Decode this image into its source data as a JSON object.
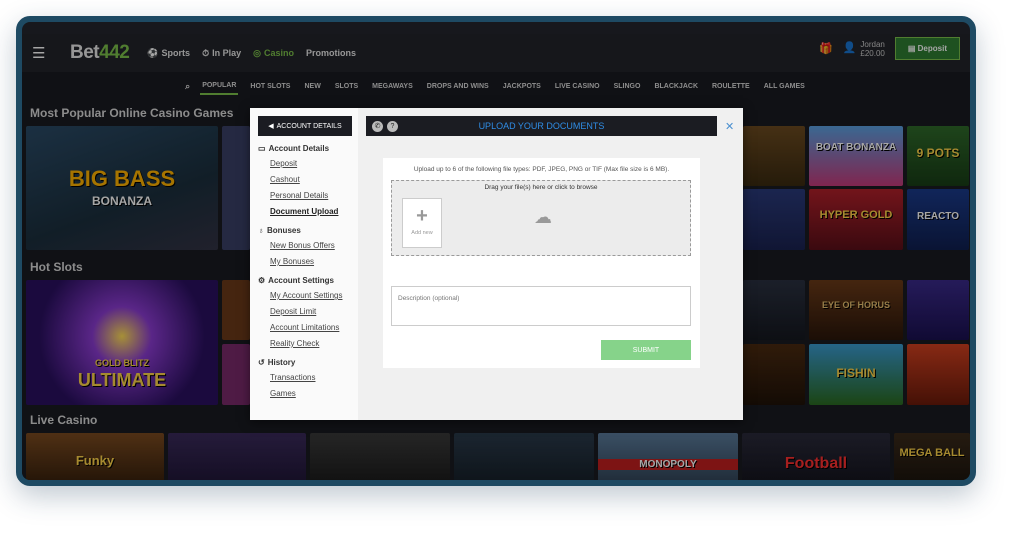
{
  "header": {
    "logo_prefix": "Bet",
    "logo_suffix": "442",
    "nav": [
      {
        "label": "Sports",
        "icon": "soccer-ball-icon"
      },
      {
        "label": "In Play",
        "icon": "stopwatch-icon"
      },
      {
        "label": "Casino",
        "icon": "chips-icon"
      },
      {
        "label": "Promotions",
        "icon": ""
      }
    ],
    "user_name": "Jordan",
    "balance": "£20.00",
    "deposit_label": "Deposit"
  },
  "categories": [
    "POPULAR",
    "HOT SLOTS",
    "NEW",
    "SLOTS",
    "MEGAWAYS",
    "DROPS AND WINS",
    "JACKPOTS",
    "LIVE CASINO",
    "SLINGO",
    "BLACKJACK",
    "ROULETTE",
    "ALL GAMES"
  ],
  "sections": {
    "popular": "Most Popular Online Casino Games",
    "hot": "Hot Slots",
    "live": "Live Casino"
  },
  "games": {
    "big_bass": "BIG BASS",
    "bonanza": "BONANZA",
    "boat_bonanza": "BOAT BONANZA",
    "nine_pots": "9 POTS",
    "hyper_gold": "HYPER GOLD",
    "reactoonz": "REACTO",
    "gold_blitz": "GOLD BLITZ",
    "ultimate": "ULTIMATE",
    "eye_of_horus": "EYE OF HORUS",
    "fishin": "FISHIN",
    "football": "Football",
    "monopoly": "MONOPOLY",
    "mega_ball": "MEGA BALL",
    "funky": "Funky"
  },
  "modal": {
    "back_label": "ACCOUNT DETAILS",
    "title": "UPLOAD YOUR DOCUMENTS",
    "groups": [
      {
        "heading": "Account Details",
        "links": [
          "Deposit",
          "Cashout",
          "Personal Details",
          "Document Upload"
        ]
      },
      {
        "heading": "Bonuses",
        "links": [
          "New Bonus Offers",
          "My Bonuses"
        ]
      },
      {
        "heading": "Account Settings",
        "links": [
          "My Account Settings",
          "Deposit Limit",
          "Account Limitations",
          "Reality Check"
        ]
      },
      {
        "heading": "History",
        "links": [
          "Transactions",
          "Games"
        ]
      }
    ],
    "info": "Upload up to 6 of the following file types: PDF, JPEG, PNG or TIF (Max file size is 6 MB).",
    "drop_label": "Drag your file(s) here or click to browse",
    "add_new": "Add new",
    "description_placeholder": "Description (optional)",
    "submit_label": "SUBMIT"
  },
  "colors": {
    "brand_green": "#7cc04a",
    "link_blue": "#2f8de6",
    "submit_green": "#86d38a"
  }
}
